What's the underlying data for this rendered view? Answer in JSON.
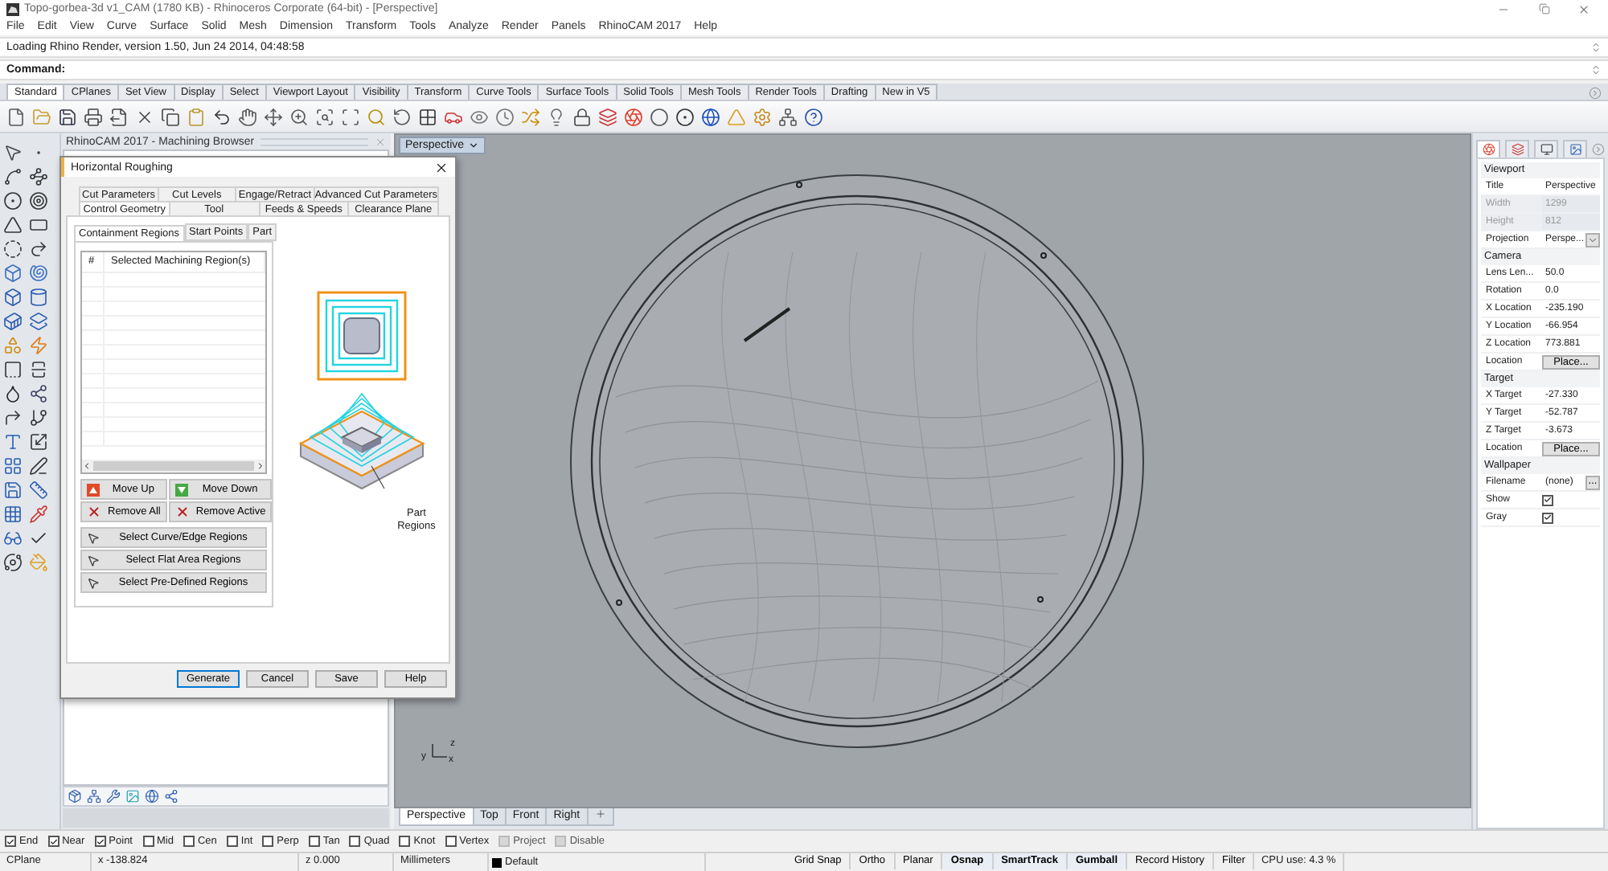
{
  "window": {
    "title": "Topo-gorbea-3d v1_CAM (1780 KB) - Rhinoceros Corporate (64-bit) - [Perspective]"
  },
  "menu": [
    "File",
    "Edit",
    "View",
    "Curve",
    "Surface",
    "Solid",
    "Mesh",
    "Dimension",
    "Transform",
    "Tools",
    "Analyze",
    "Render",
    "Panels",
    "RhinoCAM 2017",
    "Help"
  ],
  "command_history": "Loading Rhino Render, version 1.50, Jun 24 2014, 04:48:58",
  "command_prompt": "Command:",
  "toolbar_tabs": [
    {
      "label": "Standard",
      "selected": true
    },
    {
      "label": "CPlanes",
      "selected": false
    },
    {
      "label": "Set View",
      "selected": false
    },
    {
      "label": "Display",
      "selected": false
    },
    {
      "label": "Select",
      "selected": false
    },
    {
      "label": "Viewport Layout",
      "selected": false
    },
    {
      "label": "Visibility",
      "selected": false
    },
    {
      "label": "Transform",
      "selected": false
    },
    {
      "label": "Curve Tools",
      "selected": false
    },
    {
      "label": "Surface Tools",
      "selected": false
    },
    {
      "label": "Solid Tools",
      "selected": false
    },
    {
      "label": "Mesh Tools",
      "selected": false
    },
    {
      "label": "Render Tools",
      "selected": false
    },
    {
      "label": "Drafting",
      "selected": false
    },
    {
      "label": "New in V5",
      "selected": false
    }
  ],
  "browser_panel": {
    "title": "RhinoCAM 2017 - Machining Browser"
  },
  "dialog": {
    "title": "Horizontal Roughing",
    "tab_rows": [
      [
        {
          "label": "Cut Parameters",
          "selected": false
        },
        {
          "label": "Cut Levels",
          "selected": false
        },
        {
          "label": "Engage/Retract",
          "selected": false
        },
        {
          "label": "Advanced Cut Parameters",
          "selected": false
        }
      ],
      [
        {
          "label": "Control Geometry",
          "selected": true
        },
        {
          "label": "Tool",
          "selected": false
        },
        {
          "label": "Feeds & Speeds",
          "selected": false
        },
        {
          "label": "Clearance Plane",
          "selected": false
        }
      ]
    ],
    "subtabs": [
      {
        "label": "Containment Regions",
        "selected": true
      },
      {
        "label": "Start Points",
        "selected": false
      },
      {
        "label": "Part",
        "selected": false
      }
    ],
    "table": {
      "columns": [
        "#",
        "Selected Machining Region(s)"
      ]
    },
    "region_buttons": [
      {
        "label": "Move Up",
        "kind": "up"
      },
      {
        "label": "Move Down",
        "kind": "down"
      },
      {
        "label": "Remove All",
        "kind": "remove"
      },
      {
        "label": "Remove Active",
        "kind": "remove"
      }
    ],
    "select_buttons": [
      "Select Curve/Edge Regions",
      "Select Flat Area Regions",
      "Select Pre-Defined Regions"
    ],
    "illustration_label": "Part Regions",
    "footer_buttons": [
      {
        "label": "Generate",
        "focused": true
      },
      {
        "label": "Cancel",
        "focused": false
      },
      {
        "label": "Save",
        "focused": false
      },
      {
        "label": "Help",
        "focused": false
      }
    ]
  },
  "viewport": {
    "title": "Perspective",
    "axis_labels": [
      "z",
      "y",
      "x"
    ],
    "view_tabs": [
      {
        "label": "Perspective",
        "selected": true
      },
      {
        "label": "Top",
        "selected": false
      },
      {
        "label": "Front",
        "selected": false
      },
      {
        "label": "Right",
        "selected": false
      }
    ]
  },
  "properties": {
    "sections": [
      {
        "title": "Viewport",
        "rows": [
          {
            "label": "Title",
            "value": "Perspective",
            "kind": "text",
            "disabled": false
          },
          {
            "label": "Width",
            "value": "1299",
            "kind": "text",
            "disabled": true
          },
          {
            "label": "Height",
            "value": "812",
            "kind": "text",
            "disabled": true
          },
          {
            "label": "Projection",
            "value": "Perspe...",
            "kind": "dropdown",
            "disabled": false
          }
        ]
      },
      {
        "title": "Camera",
        "rows": [
          {
            "label": "Lens Len...",
            "value": "50.0",
            "kind": "text",
            "disabled": false
          },
          {
            "label": "Rotation",
            "value": "0.0",
            "kind": "text",
            "disabled": false
          },
          {
            "label": "X Location",
            "value": "-235.190",
            "kind": "text",
            "disabled": false
          },
          {
            "label": "Y Location",
            "value": "-66.954",
            "kind": "text",
            "disabled": false
          },
          {
            "label": "Z Location",
            "value": "773.881",
            "kind": "text",
            "disabled": false
          },
          {
            "label": "Location",
            "value": "Place...",
            "kind": "button",
            "disabled": false
          }
        ]
      },
      {
        "title": "Target",
        "rows": [
          {
            "label": "X Target",
            "value": "-27.330",
            "kind": "text",
            "disabled": false
          },
          {
            "label": "Y Target",
            "value": "-52.787",
            "kind": "text",
            "disabled": false
          },
          {
            "label": "Z Target",
            "value": "-3.673",
            "kind": "text",
            "disabled": false
          },
          {
            "label": "Location",
            "value": "Place...",
            "kind": "button",
            "disabled": false
          }
        ]
      },
      {
        "title": "Wallpaper",
        "rows": [
          {
            "label": "Filename",
            "value": "(none)",
            "button_label": "...",
            "kind": "file",
            "disabled": false
          },
          {
            "label": "Show",
            "kind": "checkbox",
            "checked": true,
            "disabled": false
          },
          {
            "label": "Gray",
            "kind": "checkbox",
            "checked": true,
            "disabled": false
          }
        ]
      }
    ]
  },
  "osnaps": [
    {
      "label": "End",
      "checked": true,
      "disabled": false
    },
    {
      "label": "Near",
      "checked": true,
      "disabled": false
    },
    {
      "label": "Point",
      "checked": true,
      "disabled": false
    },
    {
      "label": "Mid",
      "checked": false,
      "disabled": false
    },
    {
      "label": "Cen",
      "checked": false,
      "disabled": false
    },
    {
      "label": "Int",
      "checked": false,
      "disabled": false
    },
    {
      "label": "Perp",
      "checked": false,
      "disabled": false
    },
    {
      "label": "Tan",
      "checked": false,
      "disabled": false
    },
    {
      "label": "Quad",
      "checked": false,
      "disabled": false
    },
    {
      "label": "Knot",
      "checked": false,
      "disabled": false
    },
    {
      "label": "Vertex",
      "checked": false,
      "disabled": false
    },
    {
      "label": "Project",
      "checked": false,
      "disabled": true
    },
    {
      "label": "Disable",
      "checked": false,
      "disabled": true
    }
  ],
  "status_bar": {
    "cplane": "CPlane",
    "x": "x -138.824",
    "z": "z 0.000",
    "units": "Millimeters",
    "layer": "Default",
    "toggles": [
      {
        "label": "Grid Snap",
        "on": false
      },
      {
        "label": "Ortho",
        "on": false
      },
      {
        "label": "Planar",
        "on": false
      },
      {
        "label": "Osnap",
        "on": true
      },
      {
        "label": "SmartTrack",
        "on": true
      },
      {
        "label": "Gumball",
        "on": true
      },
      {
        "label": "Record History",
        "on": false
      },
      {
        "label": "Filter",
        "on": false
      }
    ],
    "cpu": "CPU use: 4.3 %"
  }
}
